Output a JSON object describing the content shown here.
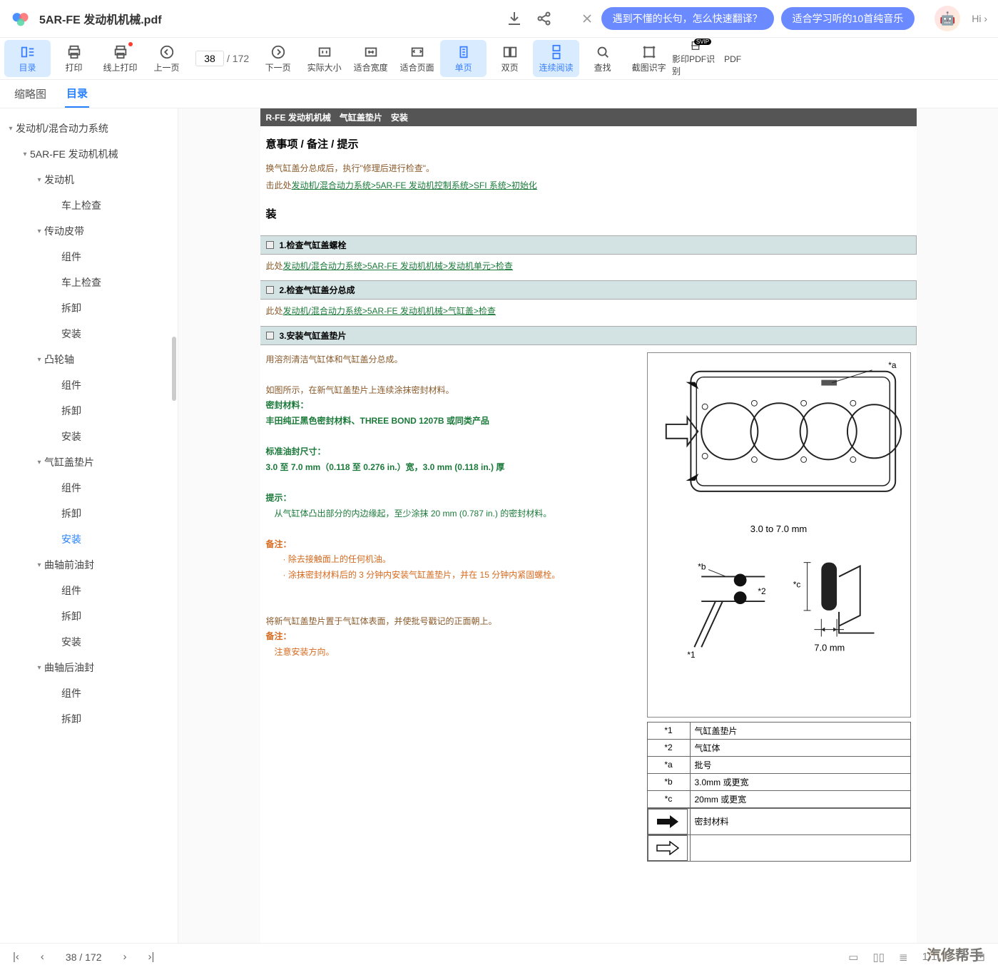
{
  "file": {
    "name": "5AR-FE 发动机机械.pdf"
  },
  "promo": {
    "pill1": "遇到不懂的长句，怎么快速翻译？",
    "pill2": "适合学习听的10首纯音乐",
    "hi": "Hi ›"
  },
  "toolbar": {
    "menu": "目录",
    "print": "打印",
    "onlinePrint": "线上打印",
    "prev": "上一页",
    "pageCur": "38",
    "pageTotal": "/ 172",
    "next": "下一页",
    "actual": "实际大小",
    "fitw": "适合宽度",
    "fitp": "适合页面",
    "single": "单页",
    "double": "双页",
    "cont": "连续阅读",
    "find": "查找",
    "crop": "截图识字",
    "scan": "影印PDF识别",
    "pdf": "PDF"
  },
  "tabs": {
    "thumb": "缩略图",
    "toc": "目录"
  },
  "tree": [
    {
      "l": 0,
      "t": "发动机/混合动力系统",
      "c": 1
    },
    {
      "l": 1,
      "t": "5AR-FE 发动机机械",
      "c": 1
    },
    {
      "l": 2,
      "t": "发动机",
      "c": 1
    },
    {
      "l": 3,
      "t": "车上检查"
    },
    {
      "l": 2,
      "t": "传动皮带",
      "c": 1
    },
    {
      "l": 3,
      "t": "组件"
    },
    {
      "l": 3,
      "t": "车上检查"
    },
    {
      "l": 3,
      "t": "拆卸"
    },
    {
      "l": 3,
      "t": "安装"
    },
    {
      "l": 2,
      "t": "凸轮轴",
      "c": 1
    },
    {
      "l": 3,
      "t": "组件"
    },
    {
      "l": 3,
      "t": "拆卸"
    },
    {
      "l": 3,
      "t": "安装"
    },
    {
      "l": 2,
      "t": "气缸盖垫片",
      "c": 1
    },
    {
      "l": 3,
      "t": "组件"
    },
    {
      "l": 3,
      "t": "拆卸"
    },
    {
      "l": 3,
      "t": "安装",
      "sel": 1
    },
    {
      "l": 2,
      "t": "曲轴前油封",
      "c": 1
    },
    {
      "l": 3,
      "t": "组件"
    },
    {
      "l": 3,
      "t": "拆卸"
    },
    {
      "l": 3,
      "t": "安装"
    },
    {
      "l": 2,
      "t": "曲轴后油封",
      "c": 1
    },
    {
      "l": 3,
      "t": "组件"
    },
    {
      "l": 3,
      "t": "拆卸"
    }
  ],
  "doc": {
    "crumb": "R-FE 发动机机械　气缸盖垫片　安装",
    "section": "意事项 / 备注 / 提示",
    "line1": "换气缸盖分总成后，执行\"修理后进行检查\"。",
    "line2_pre": "击此处",
    "line2_link": "发动机/混合动力系统>5AR-FE 发动机控制系统>SFI 系统>初始化",
    "proc": "装",
    "step1": "1.检查气缸盖螺栓",
    "s1_pre": "此处",
    "s1_link": "发动机/混合动力系统>5AR-FE 发动机机械>发动机单元>检查",
    "step2": "2.检查气缸盖分总成",
    "s2_pre": "此处",
    "s2_link": "发动机/混合动力系统>5AR-FE 发动机机械>气缸盖>检查",
    "step3": "3.安装气缸盖垫片",
    "p1": "用溶剂清洁气缸体和气缸盖分总成。",
    "p2": "如图所示，在新气缸盖垫片上连续涂抹密封材料。",
    "p3": "密封材料：",
    "p4": "丰田纯正黑色密封材料、THREE BOND 1207B 或同类产品",
    "p5": "标准油封尺寸：",
    "p6": "3.0 至 7.0 mm（0.118 至 0.276 in.）宽，3.0 mm (0.118 in.) 厚",
    "hint": "提示：",
    "hint1": "从气缸体凸出部分的内边缘起，至少涂抹 20 mm (0.787 in.) 的密封材料。",
    "note": "备注：",
    "note1": "除去接触面上的任何机油。",
    "note2": "涂抹密封材料后的 3 分钟内安装气缸盖垫片，并在 15 分钟内紧固螺栓。",
    "p7": "将新气缸盖垫片置于气缸体表面，并使批号戳记的正面朝上。",
    "note_b": "备注：",
    "note_b1": "注意安装方向。",
    "fig": {
      "dim1": "3.0 to 7.0 mm",
      "dim2": "7.0 mm",
      "a": "*a",
      "b": "*b",
      "c": "*c",
      "s1": "*1",
      "s2": "*2"
    },
    "legend": [
      {
        "k": "*1",
        "v": "气缸盖垫片"
      },
      {
        "k": "*2",
        "v": "气缸体"
      },
      {
        "k": "*a",
        "v": "批号"
      },
      {
        "k": "*b",
        "v": "3.0mm 或更宽"
      },
      {
        "k": "*c",
        "v": "20mm 或更宽"
      }
    ],
    "seal": "密封材料"
  },
  "bottom": {
    "page": "38 / 172"
  },
  "watermark": "汽修帮手"
}
